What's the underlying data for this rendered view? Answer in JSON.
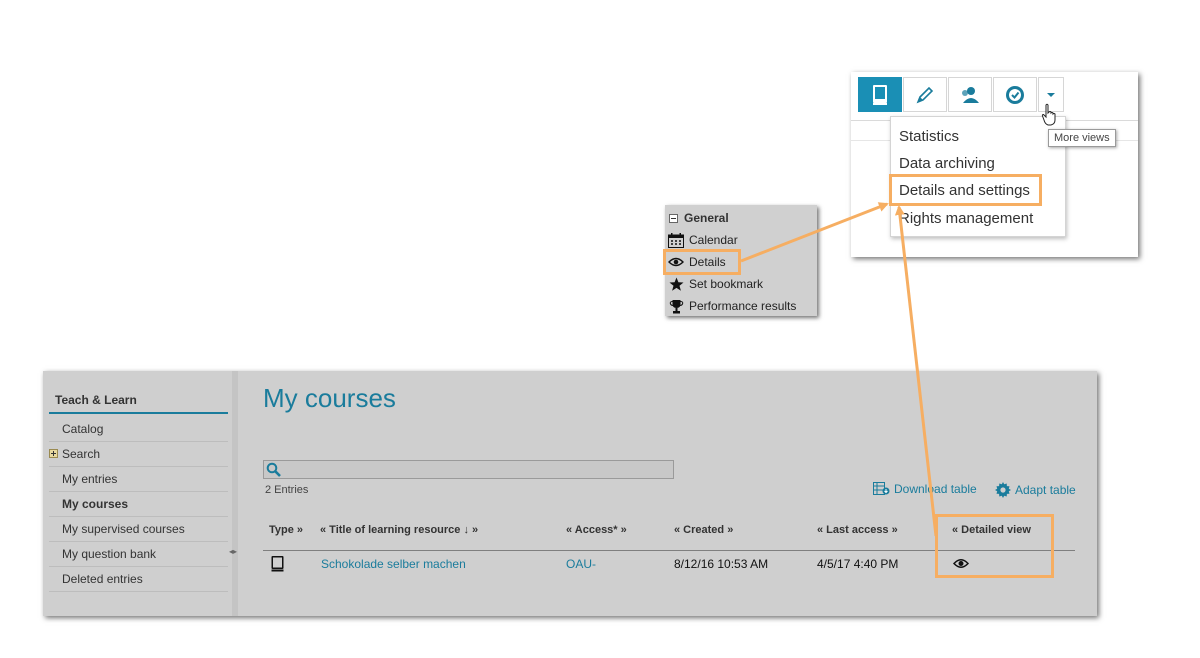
{
  "toolbar": {
    "buttons": [
      {
        "icon": "book-icon",
        "active": true
      },
      {
        "icon": "pencil-icon",
        "active": false
      },
      {
        "icon": "users-icon",
        "active": false
      },
      {
        "icon": "badge-check-icon",
        "active": false
      },
      {
        "icon": "caret-down-icon",
        "active": false
      }
    ],
    "menu_items": [
      "Statistics",
      "Data archiving",
      "Details and settings",
      "Rights management"
    ],
    "tooltip": "More views",
    "accent_color": "#1a8fb5"
  },
  "context_menu": {
    "header": "General",
    "items": [
      {
        "label": "Calendar",
        "icon": "calendar-icon"
      },
      {
        "label": "Details",
        "icon": "eye-icon"
      },
      {
        "label": "Set bookmark",
        "icon": "star-icon"
      },
      {
        "label": "Performance results",
        "icon": "trophy-icon"
      }
    ]
  },
  "sidebar": {
    "title": "Teach & Learn",
    "items": [
      "Catalog",
      "Search",
      "My entries",
      "My courses",
      "My supervised courses",
      "My question bank",
      "Deleted entries"
    ],
    "active_item": "My courses"
  },
  "main": {
    "title": "My courses",
    "entries_count": "2 Entries",
    "download_table": "Download table",
    "adapt_table": "Adapt table",
    "columns": [
      "Type »",
      "« Title of learning resource ↓ »",
      "« Access* »",
      "« Created »",
      "« Last access »",
      "« Detailed view"
    ],
    "rows": [
      {
        "type_icon": "book-icon",
        "title": "Schokolade selber machen",
        "access": "OAU-",
        "created": "8/12/16 10:53 AM",
        "last_access": "4/5/17 4:40 PM",
        "detail_icon": "eye-icon"
      }
    ]
  },
  "highlight_color": "#f6ae62"
}
